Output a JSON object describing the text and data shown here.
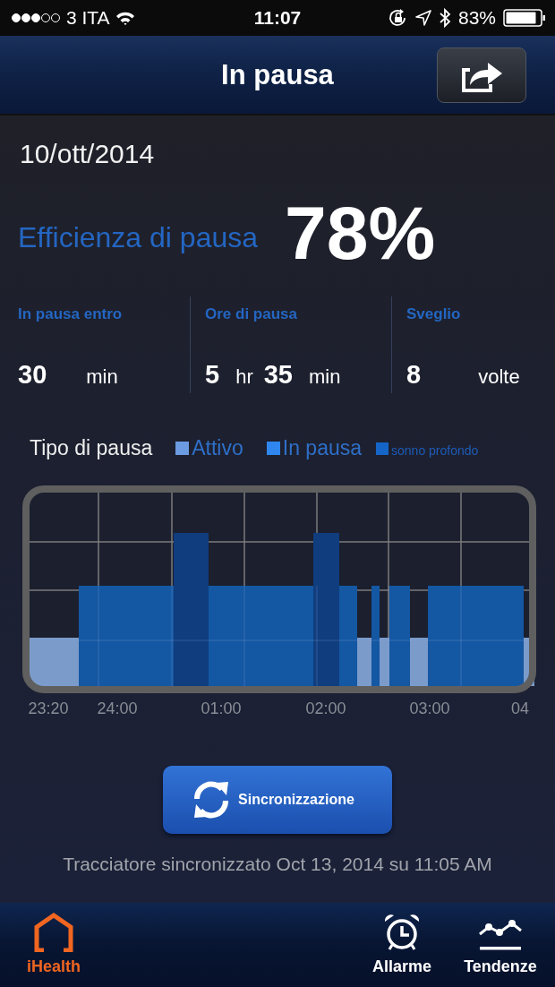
{
  "status_bar": {
    "carrier": "3 ITA",
    "time": "11:07",
    "battery": "83%"
  },
  "nav": {
    "title": "In pausa"
  },
  "date": "10/ott/2014",
  "efficiency": {
    "label": "Efficienza di pausa",
    "value": "78%"
  },
  "stats": [
    {
      "label": "In pausa entro",
      "parts": [
        {
          "kind": "number",
          "text": "30"
        },
        {
          "kind": "unit",
          "text": "min"
        }
      ]
    },
    {
      "label": "Ore di pausa",
      "parts": [
        {
          "kind": "number",
          "text": "5"
        },
        {
          "kind": "unit",
          "text": "hr"
        },
        {
          "kind": "number",
          "text": "35"
        },
        {
          "kind": "unit",
          "text": "min"
        }
      ]
    },
    {
      "label": "Sveglio",
      "parts": [
        {
          "kind": "number",
          "text": "8"
        },
        {
          "kind": "unit",
          "text": "volte"
        }
      ]
    }
  ],
  "legend": {
    "title": "Tipo di pausa",
    "items": [
      {
        "label": "Attivo",
        "color": "#6b9be0",
        "kind": "large"
      },
      {
        "label": "In pausa",
        "color": "#2f86ef",
        "kind": "large"
      },
      {
        "label": "sonno profondo",
        "color": "#1565c8",
        "kind": "small"
      }
    ]
  },
  "chart_axis": [
    "23:20",
    "24:00",
    "01:00",
    "02:00",
    "03:00",
    "04"
  ],
  "sync_button": "Sincronizzazione",
  "sync_status": "Tracciatore sincronizzato Oct 13, 2014 su 11:05 AM",
  "tabs": [
    {
      "label": "iHealth",
      "kind": "home",
      "selected": true
    },
    {
      "label": "Allarme",
      "kind": "alarm",
      "selected": false
    },
    {
      "label": "Tendenze",
      "kind": "trends",
      "selected": false
    }
  ]
}
